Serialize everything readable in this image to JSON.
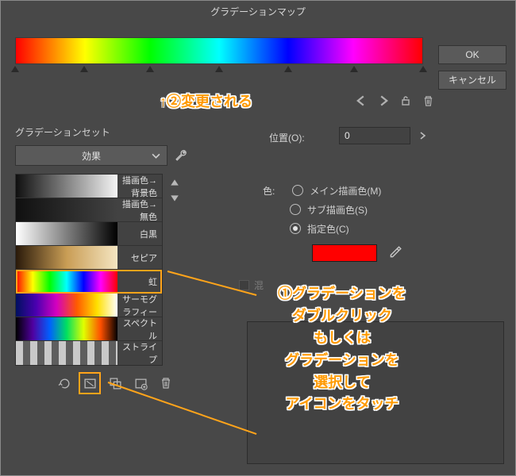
{
  "window": {
    "title": "グラデーションマップ"
  },
  "buttons": {
    "ok": "OK",
    "cancel": "キャンセル"
  },
  "gradient_bar": {
    "markers_percent": [
      0,
      17,
      33,
      50,
      67,
      83,
      100
    ]
  },
  "annotations": {
    "top": "↑②変更される",
    "steps": "①グラデーションを\nダブルクリック\nもしくは\nグラデーションを\n選択して\nアイコンをタッチ"
  },
  "position": {
    "label": "位置(O):",
    "value": "0"
  },
  "panel": {
    "title": "グラデーションセット",
    "selected_set": "効果",
    "items": [
      {
        "label": "描画色→背景色",
        "css": "linear-gradient(90deg,#101010,#f5f5f5)"
      },
      {
        "label": "描画色→無色",
        "css": "linear-gradient(90deg,#101010,rgba(0,0,0,0))"
      },
      {
        "label": "白黒",
        "css": "linear-gradient(90deg,#ffffff,#000000)"
      },
      {
        "label": "セピア",
        "css": "linear-gradient(90deg,#2a1a0a,#c99d55,#f5e6c2)"
      },
      {
        "label": "虹",
        "css": "linear-gradient(90deg,#ff0000,#ffff00,#00ff00,#00ffff,#0000ff,#ff00ff,#ff0000)",
        "selected": true
      },
      {
        "label": "サーモグラフィー",
        "css": "linear-gradient(90deg,#001060,#4a00b0,#d400c0,#ff5a00,#ffe000,#ffffff)"
      },
      {
        "label": "スペクトル",
        "css": "linear-gradient(90deg,#000000,#5000a0,#0060ff,#00e060,#e0ff00,#ff5000,#000000)"
      },
      {
        "label": "ストライプ",
        "css": "repeating-linear-gradient(90deg,#c9c9c9 0 9px,#5e5e5e 9px 18px)"
      }
    ]
  },
  "color_section": {
    "label": "色:",
    "options": [
      {
        "label": "メイン描画色(M)",
        "checked": false
      },
      {
        "label": "サブ描画色(S)",
        "checked": false
      },
      {
        "label": "指定色(C)",
        "checked": true
      }
    ],
    "swatch": "#ff0000"
  },
  "partial_label": "混"
}
